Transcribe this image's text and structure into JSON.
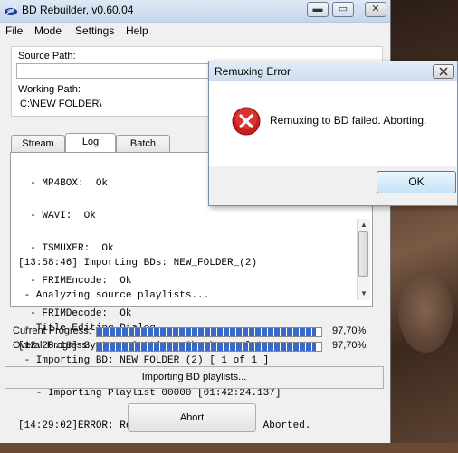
{
  "window": {
    "title": "BD Rebuilder, v0.60.04",
    "controls": {
      "minimize": "▬",
      "maximize": "▭",
      "close": "✕"
    }
  },
  "menu": [
    "File",
    "Mode",
    "Settings",
    "Help"
  ],
  "paths": {
    "source_label": "Source Path:",
    "source_value": "",
    "working_label": "Working Path:",
    "working_value": "C:\\NEW FOLDER\\"
  },
  "tabs": [
    {
      "label": "Stream",
      "active": false
    },
    {
      "label": "Log",
      "active": true
    },
    {
      "label": "Batch",
      "active": false
    }
  ],
  "log": {
    "upper": [
      "  - MP4BOX:  Ok",
      "  - WAVI:  Ok",
      "  - TSMUXER:  Ok",
      "  - FRIMEncode:  Ok",
      "  - FRIMDecode:  Ok",
      "[12.28.18] Systems Settings Check complete"
    ],
    "lower": [
      "[13:58:46] Importing BDs: NEW_FOLDER_(2)",
      " - Analyzing source playlists...",
      " - Title Editing Dialog...",
      " - Importing BD: NEW FOLDER (2) [ 1 of 1 ]",
      "   - Importing Playlist 00000 [01:42:24.137]",
      "[14:29:02]ERROR: Remuxing to BD failed.  Aborted."
    ]
  },
  "progress": {
    "current_label": "Current Progress:",
    "current_value": 0.977,
    "current_text": "97,70%",
    "overall_label": "Overall Progress:",
    "overall_value": 0.977,
    "overall_text": "97,70%"
  },
  "status": "Importing BD playlists...",
  "abort_label": "Abort",
  "dialog": {
    "title": "Remuxing Error",
    "close": "✕",
    "message": "Remuxing to BD failed.  Aborting.",
    "ok_label": "OK"
  },
  "colors": {
    "progress": "#3a68c8",
    "error": "#c81e1e",
    "accent": "#3c7fb1"
  }
}
